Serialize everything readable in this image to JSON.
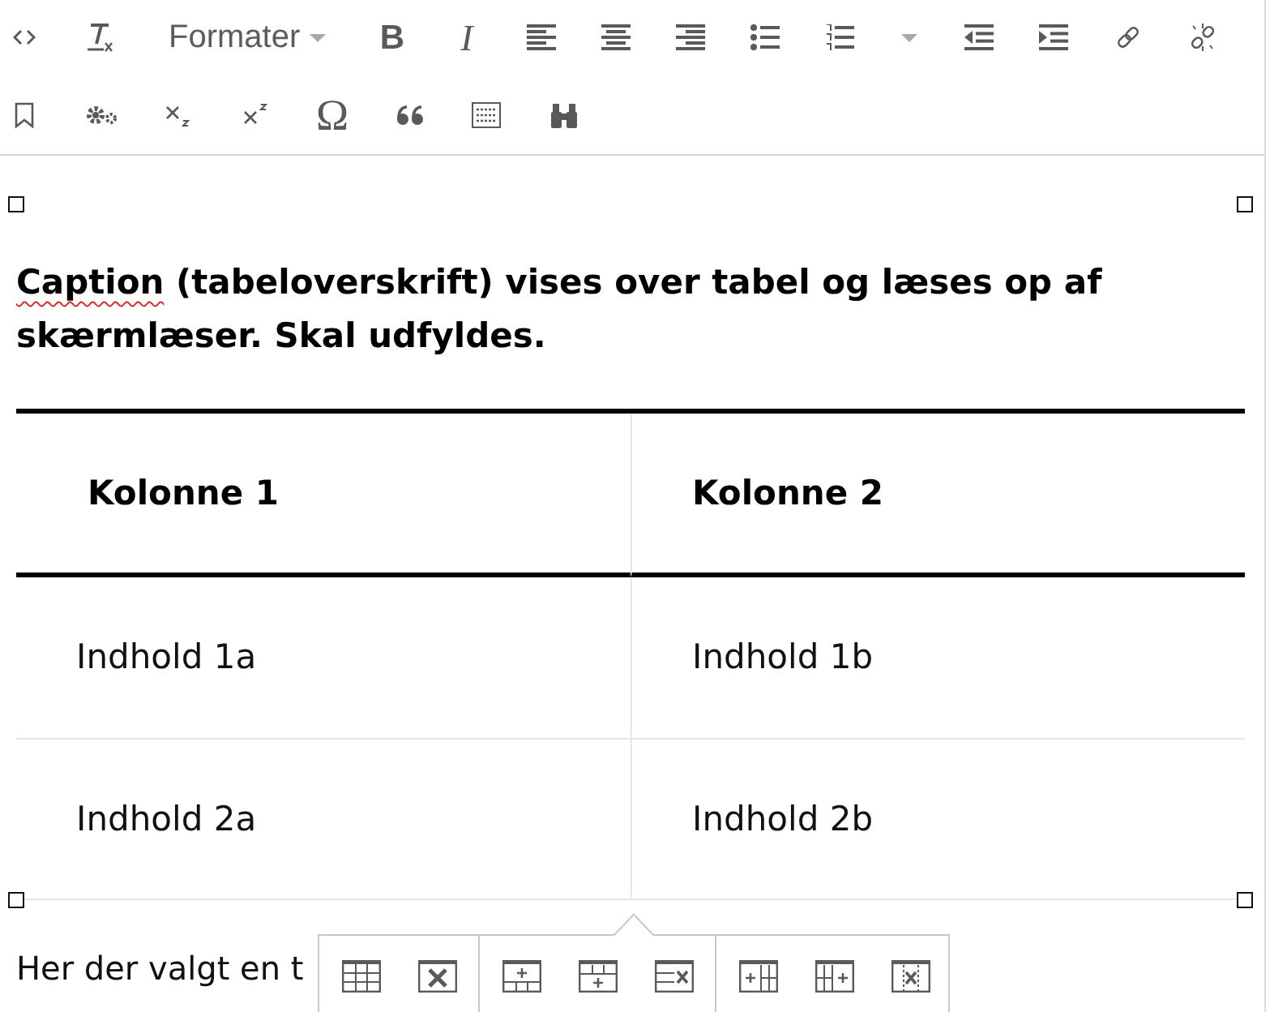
{
  "toolbar": {
    "format_menu": {
      "label": "Formater"
    },
    "bold": {
      "label": "B"
    },
    "italic": {
      "label": "I"
    },
    "special_character": {
      "label": "Ω"
    }
  },
  "editor": {
    "caption": [
      {
        "text": "Caption",
        "misspelled": true
      },
      {
        "text": " (tabeloverskrift) vises over tabel og læses op af skærmlæser. Skal udfyldes.",
        "misspelled": false
      }
    ],
    "table": {
      "columns": [
        "Kolonne 1",
        "Kolonne 2"
      ],
      "rows": [
        [
          "Indhold 1a",
          "Indhold 1b"
        ],
        [
          "Indhold 2a",
          "Indhold 2b"
        ]
      ]
    },
    "paragraph": "Her der valgt en t"
  }
}
